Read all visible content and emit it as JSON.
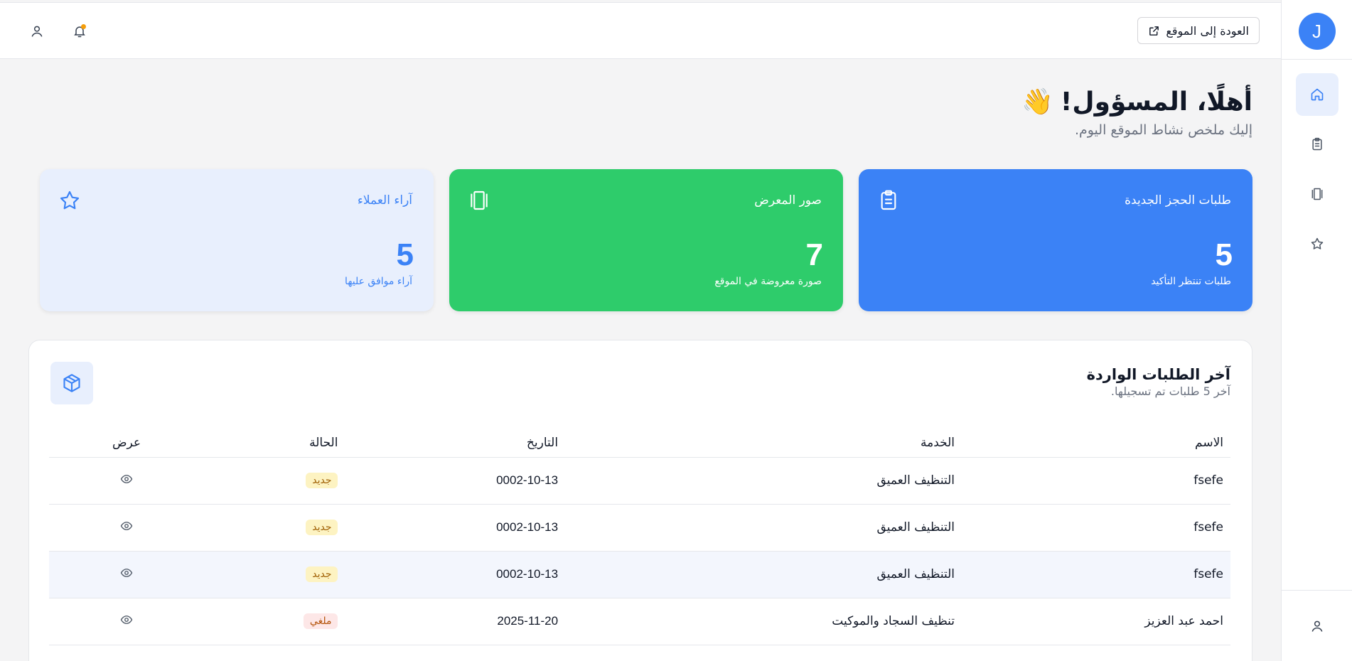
{
  "sidebar": {
    "avatar_letter": "J",
    "nav": [
      "home-icon",
      "clipboard-icon",
      "gallery-icon",
      "star-icon"
    ],
    "bottom": "user-icon"
  },
  "header": {
    "back_label": "العودة إلى الموقع"
  },
  "welcome": {
    "title": "أهلًا، المسؤول!",
    "emoji": "👋",
    "subtitle": "إليك ملخص نشاط الموقع اليوم."
  },
  "cards": {
    "bookings": {
      "title": "طلبات الحجز الجديدة",
      "value": "5",
      "desc": "طلبات تنتظر التأكيد",
      "color": "#3b82f6"
    },
    "gallery": {
      "title": "صور المعرض",
      "value": "7",
      "desc": "صورة معروضة في الموقع",
      "color": "#2ecc6b"
    },
    "reviews": {
      "title": "آراء العملاء",
      "value": "5",
      "desc": "آراء موافق عليها",
      "color": "#e8effd"
    }
  },
  "orders": {
    "title": "آخر الطلبات الواردة",
    "subtitle": "آخر 5 طلبات تم تسجيلها.",
    "columns": {
      "name": "الاسم",
      "service": "الخدمة",
      "date": "التاريخ",
      "status": "الحالة",
      "view": "عرض"
    },
    "rows": [
      {
        "name": "fsefe",
        "service": "التنظيف العميق",
        "date": "0002-10-13",
        "status": "جديد",
        "status_type": "new"
      },
      {
        "name": "fsefe",
        "service": "التنظيف العميق",
        "date": "0002-10-13",
        "status": "جديد",
        "status_type": "new"
      },
      {
        "name": "fsefe",
        "service": "التنظيف العميق",
        "date": "0002-10-13",
        "status": "جديد",
        "status_type": "new"
      },
      {
        "name": "احمد عبد العزيز",
        "service": "تنظيف السجاد والموكيت",
        "date": "2025-11-20",
        "status": "ملغي",
        "status_type": "cancel"
      }
    ]
  }
}
